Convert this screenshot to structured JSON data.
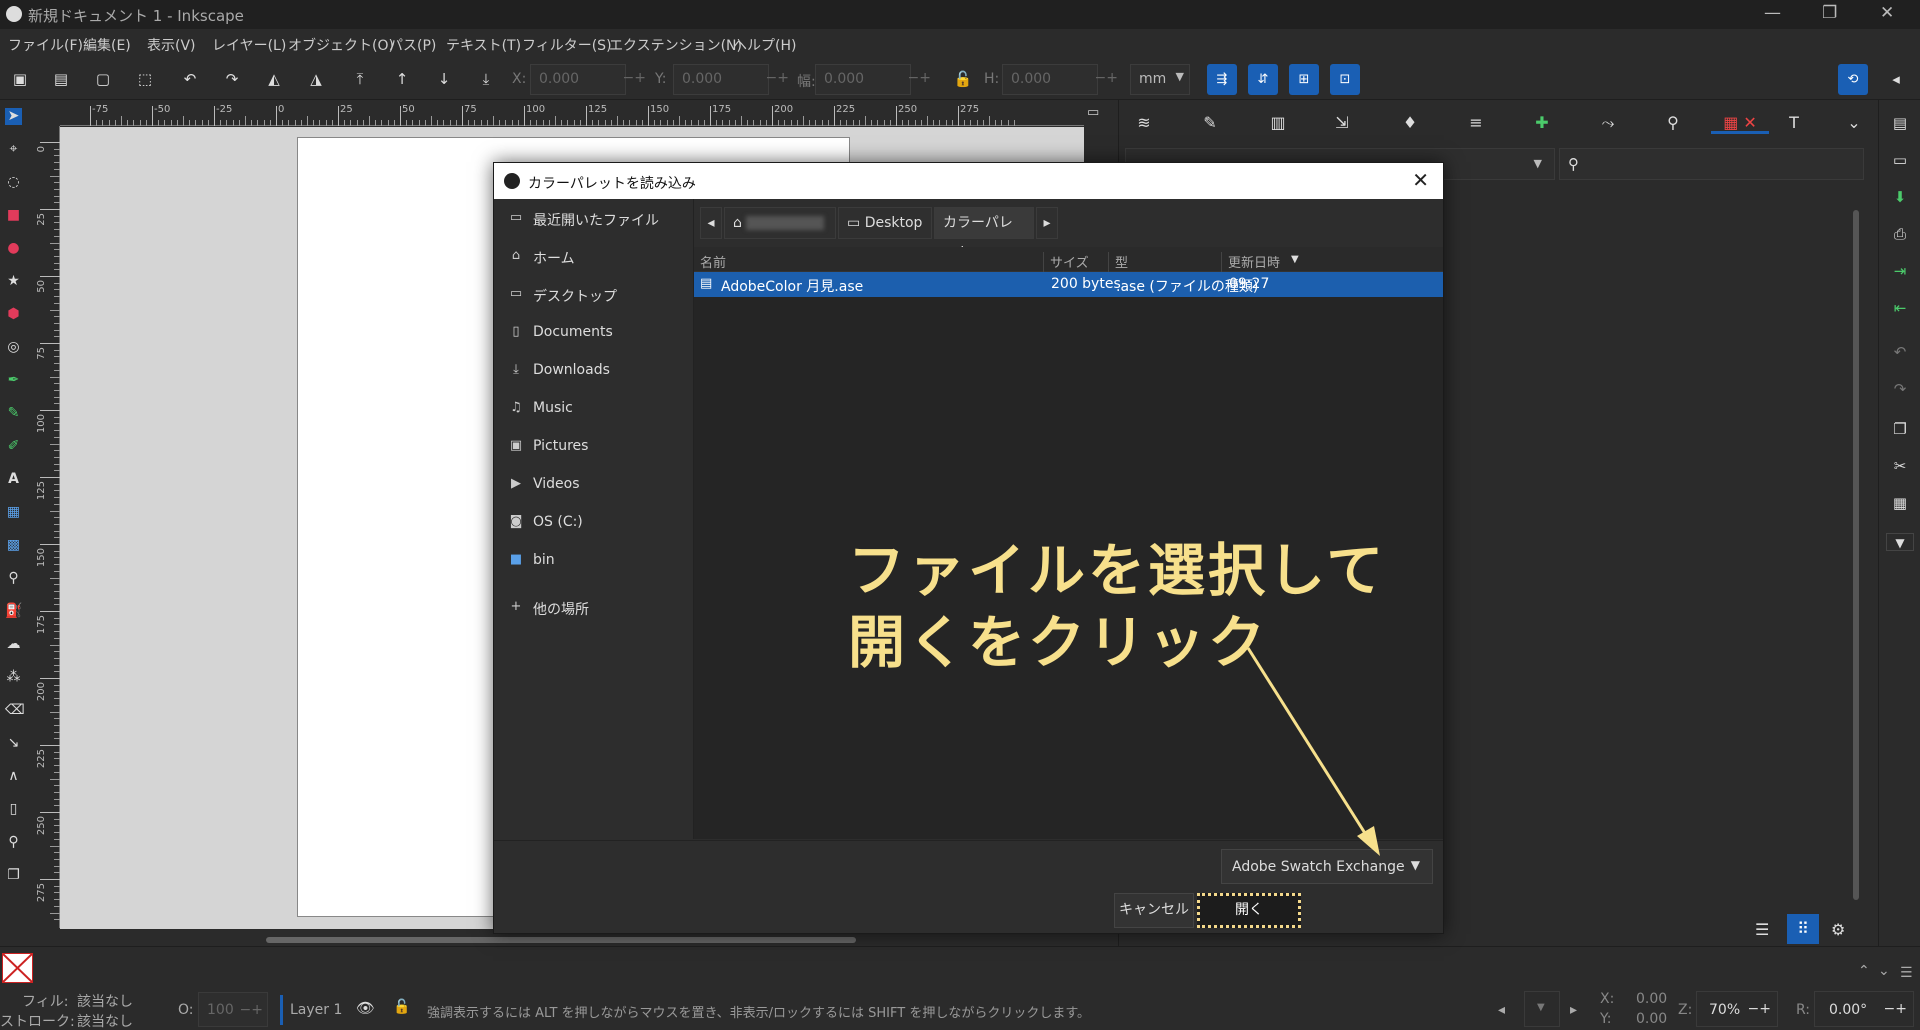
{
  "window": {
    "title": "新規ドキュメント 1 - Inkscape"
  },
  "menu": [
    "ファイル(F)",
    "編集(E)",
    "表示(V)",
    "レイヤー(L)",
    "オブジェクト(O)",
    "パス(P)",
    "テキスト(T)",
    "フィルター(S)",
    "エクステンション(N)",
    "ヘルプ(H)"
  ],
  "toolbar": {
    "x_label": "X:",
    "x_value": "0.000",
    "y_label": "Y:",
    "y_value": "0.000",
    "w_label": "幅:",
    "w_value": "0.000",
    "h_label": "H:",
    "h_value": "0.000",
    "unit": "mm"
  },
  "ruler": {
    "h_ticks": [
      "-75",
      "-50",
      "-25",
      "0",
      "25",
      "50",
      "75",
      "100",
      "125",
      "150",
      "175",
      "200",
      "225",
      "250",
      "275"
    ],
    "v_ticks": [
      "0",
      "25",
      "50",
      "75",
      "100",
      "125",
      "150",
      "175",
      "200",
      "225",
      "250",
      "275"
    ]
  },
  "dialog": {
    "title": "カラーパレットを読み込み",
    "places": [
      "最近開いたファイル",
      "ホーム",
      "デスクトップ",
      "Documents",
      "Downloads",
      "Music",
      "Pictures",
      "Videos",
      "OS (C:)",
      "bin",
      "他の場所"
    ],
    "path": [
      "Desktop",
      "カラーパレット"
    ],
    "columns": {
      "name": "名前",
      "size": "サイズ",
      "type": "型",
      "modified": "更新日時"
    },
    "files": [
      {
        "name": "AdobeColor 月見.ase",
        "size": "200 bytes",
        "type": ".ase (ファイルの種類)",
        "modified": "09:27"
      }
    ],
    "filter": "Adobe Swatch Exchange",
    "cancel": "キャンセル",
    "open": "開く"
  },
  "annotation": {
    "line1": "ファイルを選択して",
    "line2": "開くをクリック",
    "color": "#f7e08c"
  },
  "status": {
    "fill_label": "フィル:",
    "fill_value": "該当なし",
    "stroke_label": "ストローク:",
    "stroke_value": "該当なし",
    "opacity_label": "O:",
    "opacity_value": "100",
    "layer": "Layer 1",
    "message": "強調表示するには ALT を押しながらマウスを置き、非表示/ロックするには SHIFT を押しながらクリックします。",
    "x_label": "X:",
    "x_value": "0.00",
    "y_label": "Y:",
    "y_value": "0.00",
    "zoom_label": "Z:",
    "zoom_value": "70%",
    "rotate_label": "R:",
    "rotate_value": "0.00°"
  },
  "colors": {
    "accent": "#1a5fb4",
    "selection": "#1c5fae"
  }
}
